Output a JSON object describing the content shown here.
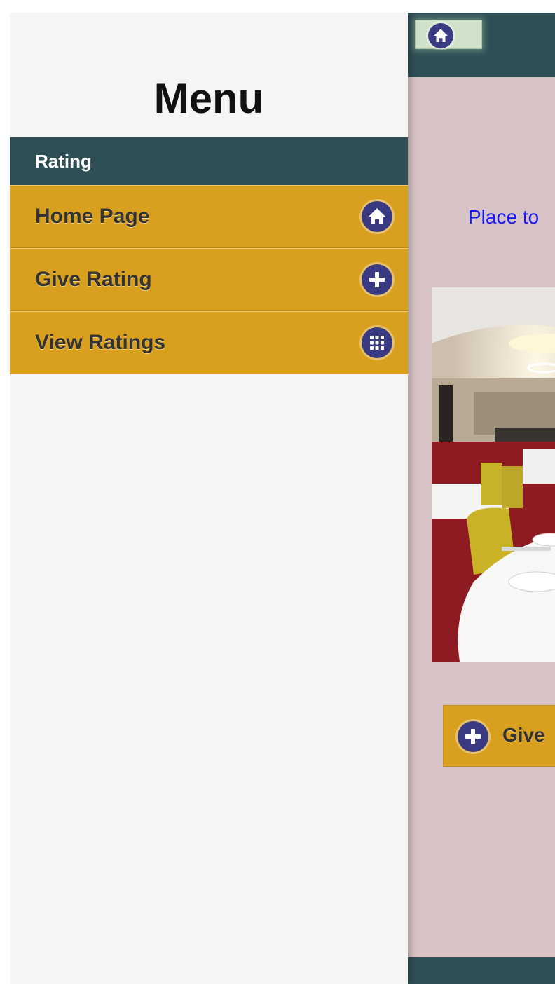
{
  "panel": {
    "title": "Menu",
    "divider": "Rating",
    "items": [
      {
        "label": "Home Page",
        "icon": "home-icon"
      },
      {
        "label": "Give Rating",
        "icon": "plus-icon"
      },
      {
        "label": "View Ratings",
        "icon": "grid-icon"
      }
    ]
  },
  "page": {
    "tagline": "Place to",
    "give_button_label": "Give"
  },
  "colors": {
    "header": "#2f4f56",
    "menu_item": "#d9a020",
    "icon_circle": "#3a3a82",
    "page_background": "#d8c4c6",
    "tagline": "#1a1aee"
  }
}
